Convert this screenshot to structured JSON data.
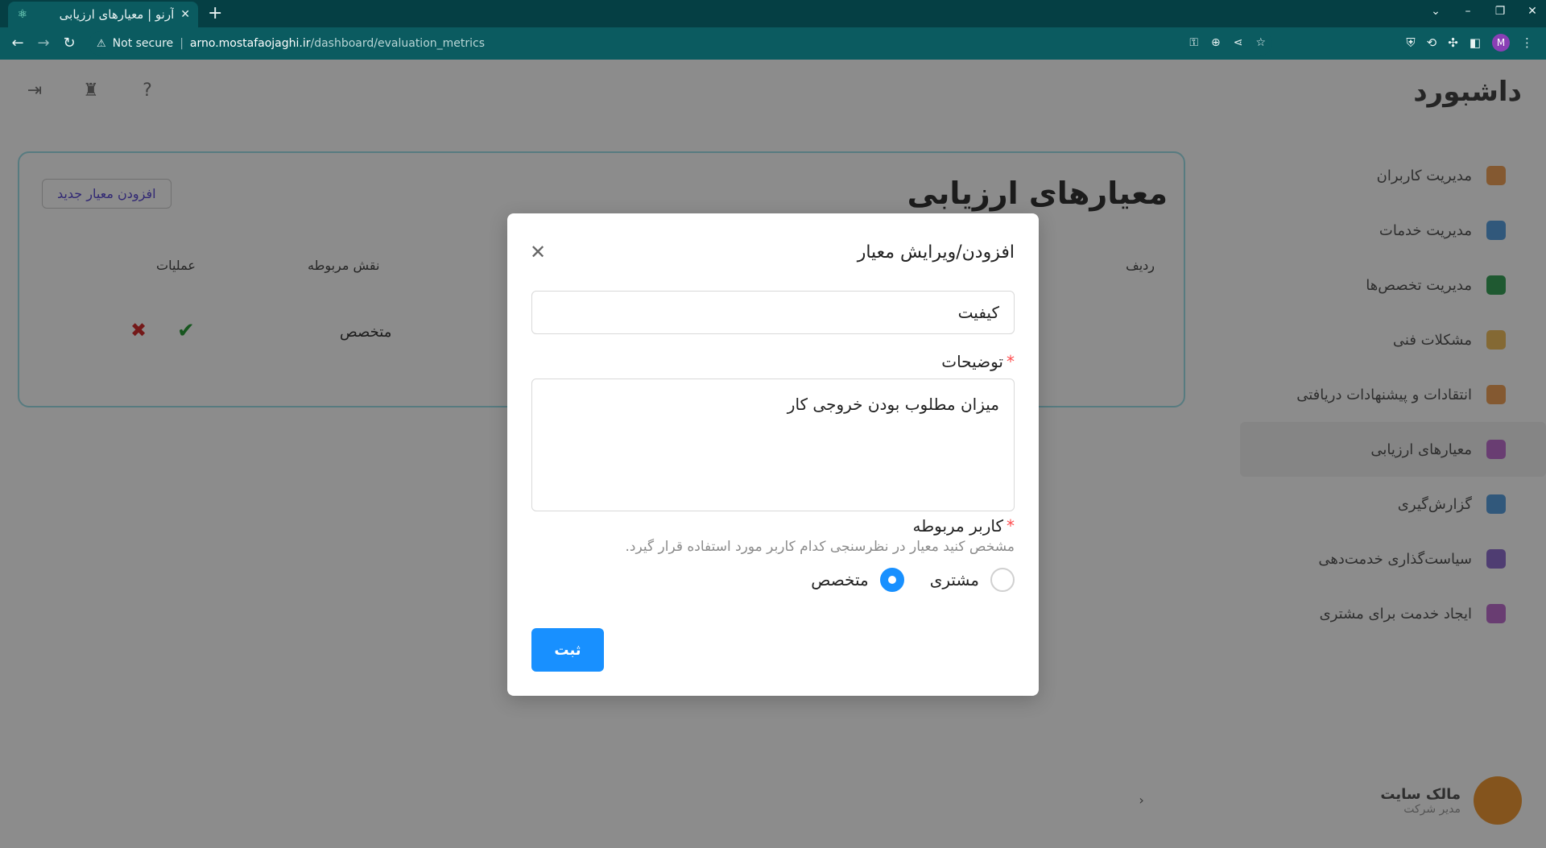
{
  "browser": {
    "tab_title": "آرنو | معیارهای ارزیابی",
    "not_secure": "Not secure",
    "host": "arno.mostafaojaghi.ir",
    "path": "/dashboard/evaluation_metrics",
    "profile_initial": "M"
  },
  "page": {
    "app_title": "داشبورد",
    "sidebar": [
      {
        "label": "مدیریت کاربران",
        "color": "#f0a35a"
      },
      {
        "label": "مدیریت خدمات",
        "color": "#5aa0e0"
      },
      {
        "label": "مدیریت تخصص‌ها",
        "color": "#3aa35a"
      },
      {
        "label": "مشکلات فنی",
        "color": "#f0c060"
      },
      {
        "label": "انتقادات و پیشنهادات دریافتی",
        "color": "#f0a35a"
      },
      {
        "label": "معیارهای ارزیابی",
        "color": "#c070d0"
      },
      {
        "label": "گزارش‌گیری",
        "color": "#5aa0e0"
      },
      {
        "label": "سیاست‌گذاری خدمت‌دهی",
        "color": "#9070d0"
      },
      {
        "label": "ایجاد خدمت برای مشتری",
        "color": "#c070d0"
      }
    ],
    "user": {
      "name": "مالک سایت",
      "role": "مدیر شرکت"
    },
    "card": {
      "title": "معیارهای ارزیابی",
      "add_button": "افزودن معیار جدید",
      "col_row": "ردیف",
      "col_role": "نقش مربوطه",
      "col_actions": "عملیات",
      "row_role": "متخصص"
    }
  },
  "modal": {
    "title": "افزودن/ویرایش معیار",
    "name_value": "کیفیت",
    "description_label": "توضیحات",
    "description_value": "میزان مطلوب بودن خروجی کار",
    "related_user_label": "کاربر مربوطه",
    "related_user_help": "مشخص کنید معیار در نظرسنجی کدام کاربر مورد استفاده قرار گیرد.",
    "options": {
      "customer": "مشتری",
      "expert": "متخصص"
    },
    "selected": "expert",
    "submit": "ثبت"
  }
}
